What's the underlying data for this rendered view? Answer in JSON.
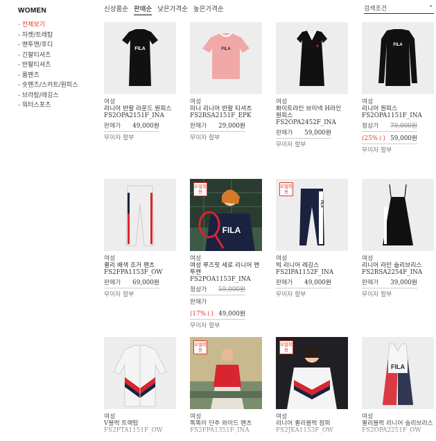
{
  "sidebar": {
    "title": "WOMEN",
    "items": [
      {
        "label": "- 전체보기",
        "active": true
      },
      {
        "label": "- 자켓/트레탑"
      },
      {
        "label": "- 맨투맨/후디"
      },
      {
        "label": "- 긴팔티셔츠"
      },
      {
        "label": "- 반팔티셔츠"
      },
      {
        "label": "- 롱팬츠"
      },
      {
        "label": "- 숏팬츠/스커트/원피스"
      },
      {
        "label": "- 브라탑/레깅스"
      },
      {
        "label": "- 워터스포츠"
      }
    ]
  },
  "sort": {
    "options": [
      {
        "label": "신상품순"
      },
      {
        "label": "판매순",
        "active": true
      },
      {
        "label": "낮은가격순"
      },
      {
        "label": "높은가격순"
      }
    ]
  },
  "filter": {
    "label": "검색조건",
    "icon": "dot-icon"
  },
  "products": [
    {
      "gender": "여성",
      "name": "리니어 반팔 라운드 원피스",
      "code": "FS2OPA2151F_INA",
      "price_label": "판매가",
      "price": "49,000원",
      "shipping": "무이자 할부",
      "thumb": "navy-tee-dress"
    },
    {
      "gender": "여성",
      "name": "미니 리니어 반팔 티셔츠",
      "code": "FS2RSA2151F_EPK",
      "price_label": "판매가",
      "price": "29,000원",
      "shipping": "무이자 할부",
      "thumb": "pink-tee"
    },
    {
      "gender": "여성",
      "name": "화이트라인 브이넥 H라인 원피스",
      "code": "FS2OPA2452F_INA",
      "price_label": "판매가",
      "price": "59,000원",
      "shipping": "무이자 할부",
      "thumb": "vneck-dress"
    },
    {
      "gender": "여성",
      "name": "리니어 원피스",
      "code": "FS2OPA1151F_INA",
      "orig_label": "정상가",
      "orig_price": "79,000원",
      "discount": "(25%↓)",
      "price": "59,000원",
      "shipping": "무이자 할부",
      "thumb": "sweat-dress"
    },
    {
      "gender": "여성",
      "name": "퀼리 배색 조거 팬츠",
      "code": "FS2FPA1153F_OW",
      "price_label": "판매가",
      "price": "69,000원",
      "shipping": "무이자 할부",
      "thumb": "jogger"
    },
    {
      "gender": "여성",
      "name": "여성 루즈핏 세로 리니어 맨투맨",
      "code": "FS2POA1153F_INA",
      "orig_label": "정상가",
      "orig_price": "59,000원",
      "price_label": "판매가",
      "discount": "(17%↓)",
      "price": "49,000원",
      "shipping": "무이자 할부",
      "thumb": "model-tennis",
      "badge": "모델착용"
    },
    {
      "gender": "여성",
      "name": "빅 리니어 레깅스",
      "code": "FS2IPA1152F_INA",
      "price_label": "판매가",
      "price": "49,000원",
      "shipping": "무이자 할부",
      "thumb": "leggings",
      "badge": "모델착용"
    },
    {
      "gender": "여성",
      "name": "리니어 라인 슬리브리스",
      "code": "FS2RSA2254F_INA",
      "price_label": "판매가",
      "price": "39,000원",
      "shipping": "무이자 할부",
      "thumb": "slip-dress"
    },
    {
      "gender": "여성",
      "name": "V블럭 트랙탑",
      "code": "FS2FTA1151F_OW",
      "thumb": "track-top"
    },
    {
      "gender": "여성",
      "name": "똑똑이 단추 와이드 팬츠",
      "code": "FS2FPA1351F_INA",
      "thumb": "model-car",
      "badge": "모델착용"
    },
    {
      "gender": "여성",
      "name": "리니어 퀼리블럭 점퍼",
      "code": "FS2JKA1153F_OW",
      "thumb": "model-jacket",
      "badge": "모델착용"
    },
    {
      "gender": "여성",
      "name": "퀼리블럭 리니어 슬리브리스",
      "code": "FS2OPA2251F_OW",
      "thumb": "tank-dress"
    }
  ]
}
